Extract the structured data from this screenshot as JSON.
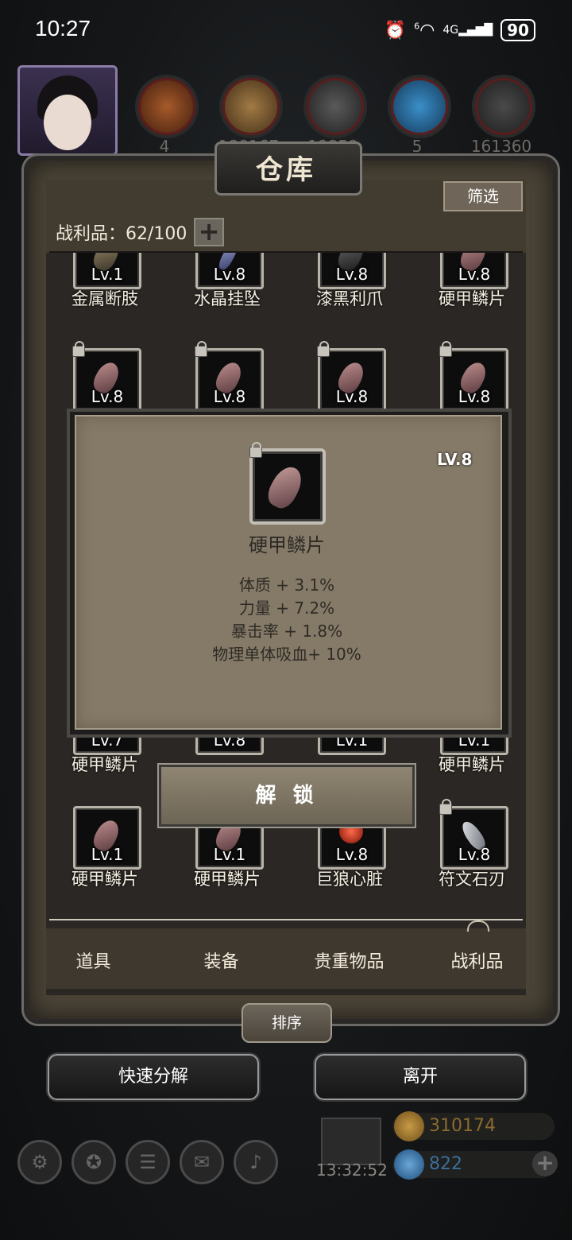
{
  "status_bar": {
    "time": "10:27",
    "battery": "90",
    "network_label": "4G",
    "wifi_sup": "6"
  },
  "resources_top": {
    "counts": [
      "4",
      "180167",
      "19859",
      "5",
      "161360"
    ]
  },
  "panel": {
    "title": "仓库",
    "filter_label": "筛选",
    "capacity_label": "战利品：62/100",
    "plus_symbol": "+"
  },
  "items": [
    {
      "level": "Lv.1",
      "name": "金属断肢",
      "locked": false
    },
    {
      "level": "Lv.8",
      "name": "水晶挂坠",
      "locked": false
    },
    {
      "level": "Lv.8",
      "name": "漆黑利爪",
      "locked": false
    },
    {
      "level": "Lv.8",
      "name": "硬甲鳞片",
      "locked": false
    },
    {
      "level": "Lv.8",
      "name": "",
      "locked": true
    },
    {
      "level": "Lv.8",
      "name": "",
      "locked": true
    },
    {
      "level": "Lv.8",
      "name": "",
      "locked": true
    },
    {
      "level": "Lv.8",
      "name": "",
      "locked": true
    },
    {
      "level": "Lv.7",
      "name": "硬甲鳞片",
      "locked": false
    },
    {
      "level": "Lv.8",
      "name": "",
      "locked": false
    },
    {
      "level": "Lv.1",
      "name": "",
      "locked": false
    },
    {
      "level": "Lv.1",
      "name": "硬甲鳞片",
      "locked": false
    },
    {
      "level": "Lv.1",
      "name": "硬甲鳞片",
      "locked": false
    },
    {
      "level": "Lv.1",
      "name": "硬甲鳞片",
      "locked": false
    },
    {
      "level": "Lv.8",
      "name": "巨狼心脏",
      "locked": false
    },
    {
      "level": "Lv.8",
      "name": "符文石刃",
      "locked": true
    }
  ],
  "tabs": [
    "道具",
    "装备",
    "贵重物品",
    "战利品"
  ],
  "active_tab": "战利品",
  "sort_label": "排序",
  "actions": {
    "quick_decompose": "快速分解",
    "leave": "离开"
  },
  "footer": {
    "timer": "13:32:52",
    "gold": "310174",
    "gems": "822",
    "plus_symbol": "+"
  },
  "dialog": {
    "level": "LV.8",
    "item_name": "硬甲鳞片",
    "stats": [
      "体质 + 3.1%",
      "力量 + 7.2%",
      "暴击率 + 1.8%",
      "物理单体吸血+ 10%"
    ],
    "unlock_label": "解 锁"
  },
  "colors": {
    "panel": "#4a4336",
    "dialog": "#857a68",
    "button": "#8f8572"
  }
}
